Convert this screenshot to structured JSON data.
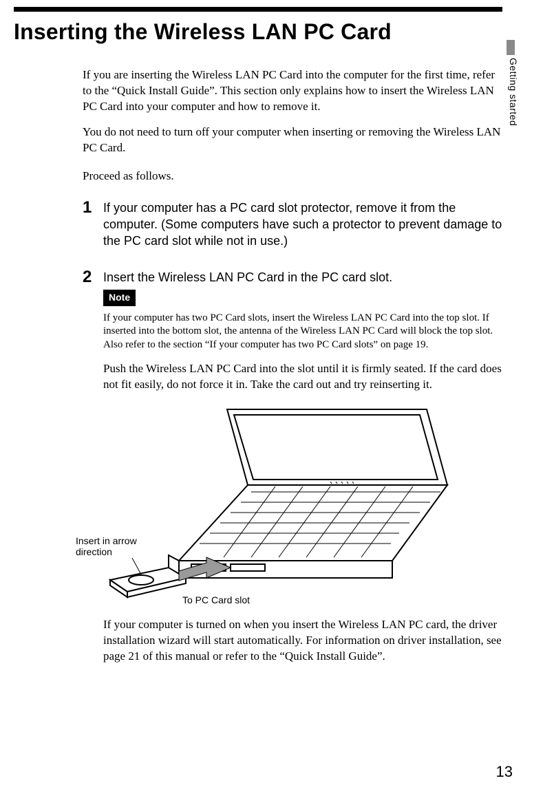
{
  "sideTab": "Getting started",
  "title": "Inserting the Wireless LAN PC Card",
  "intro": [
    "If you are inserting the Wireless LAN PC Card into the computer for the first time, refer to the “Quick Install Guide”. This section only explains how to insert the Wireless LAN PC Card into your computer and how to remove it.",
    "You do not need to turn off your computer when inserting or removing the Wireless LAN PC Card.",
    "Proceed as follows."
  ],
  "steps": [
    {
      "num": "1",
      "text": "If your computer has a PC card slot protector, remove it from the computer. (Some computers have such a protector to prevent damage to the PC card slot while not in use.)"
    },
    {
      "num": "2",
      "text": "Insert the Wireless LAN PC Card in the PC card slot.",
      "noteLabel": "Note",
      "noteText": "If your computer has two PC Card slots, insert the Wireless LAN PC Card into the top slot. If inserted into the bottom slot, the antenna of the Wireless LAN PC Card will block the top slot. Also refer to the section “If your computer has two PC Card slots” on page 19.",
      "afterNote": "Push the Wireless LAN PC Card into the slot until it is firmly seated. If the card does not fit easily, do not force it in. Take the card out and try reinserting it.",
      "illus": {
        "label1a": "Insert in arrow",
        "label1b": "direction",
        "label2": "To PC Card slot"
      },
      "afterIllus": "If your computer is turned on when you insert the Wireless LAN PC card, the driver installation wizard will start automatically. For information on driver installation, see page 21 of this manual or refer to the “Quick Install Guide”."
    }
  ],
  "pageNumber": "13"
}
